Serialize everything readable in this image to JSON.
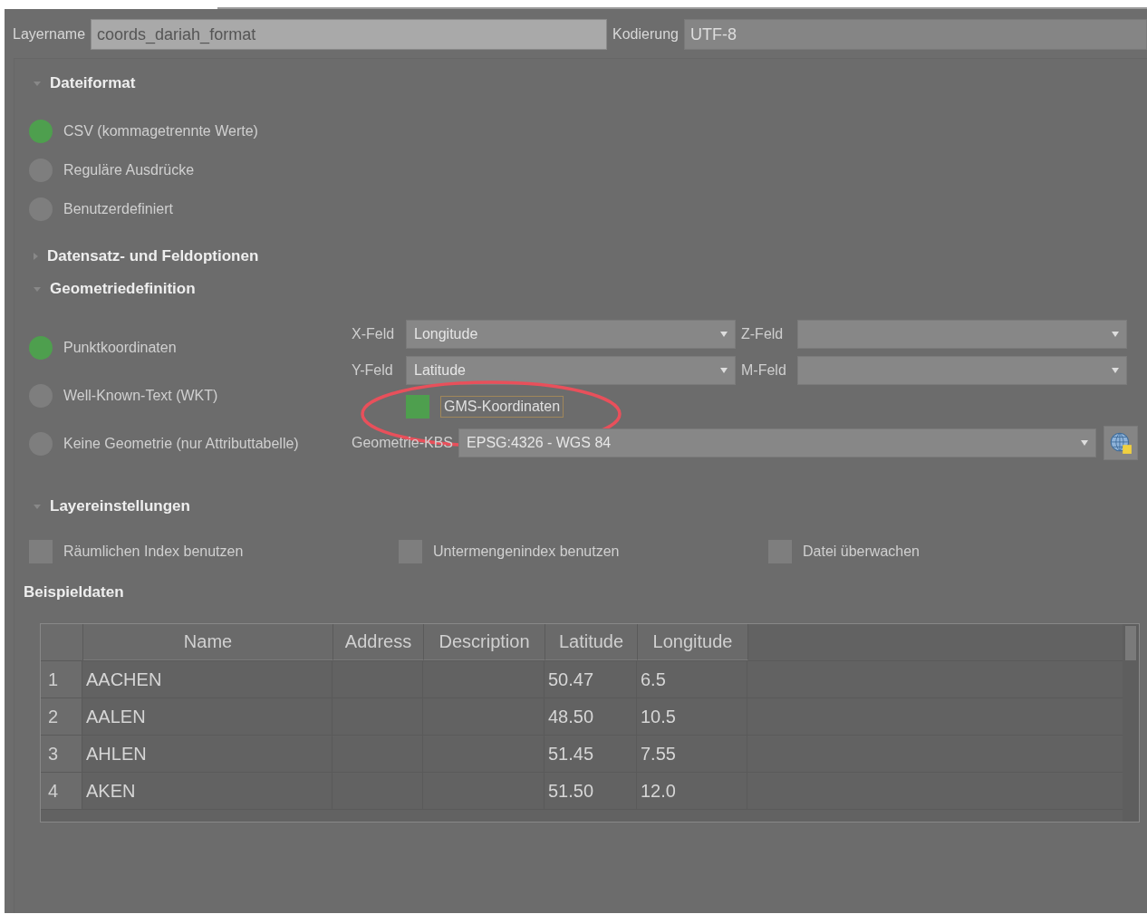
{
  "layer_name": {
    "label": "Layername",
    "value": "coords_dariah_format"
  },
  "encoding": {
    "label": "Kodierung",
    "value": "UTF-8"
  },
  "file_format": {
    "title": "Dateiformat",
    "expanded": true,
    "options": [
      {
        "label": "CSV (kommagetrennte Werte)",
        "selected": true
      },
      {
        "label": "Reguläre Ausdrücke",
        "selected": false
      },
      {
        "label": "Benutzerdefiniert",
        "selected": false
      }
    ]
  },
  "record_options": {
    "title": "Datensatz- und Feldoptionen",
    "expanded": false
  },
  "geometry": {
    "title": "Geometriedefinition",
    "expanded": true,
    "options": [
      {
        "label": "Punktkoordinaten",
        "selected": true
      },
      {
        "label": "Well-Known-Text (WKT)",
        "selected": false
      },
      {
        "label": "Keine Geometrie (nur Attributtabelle)",
        "selected": false
      }
    ],
    "x_field": {
      "label": "X-Feld",
      "value": "Longitude"
    },
    "z_field": {
      "label": "Z-Feld"
    },
    "y_field": {
      "label": "Y-Feld",
      "value": "Latitude"
    },
    "m_field": {
      "label": "M-Feld"
    },
    "dms": {
      "label": "GMS-Koordinaten",
      "checked": true
    },
    "crs": {
      "label": "Geometrie-KBS",
      "value": "EPSG:4326 - WGS 84"
    }
  },
  "layer_settings": {
    "title": "Layereinstellungen",
    "expanded": true,
    "options": [
      {
        "label": "Räumlichen Index benutzen",
        "checked": false
      },
      {
        "label": "Untermengenindex benutzen",
        "checked": false
      },
      {
        "label": "Datei überwachen",
        "checked": false
      }
    ]
  },
  "sample_data": {
    "title": "Beispieldaten",
    "columns": [
      "Name",
      "Address",
      "Description",
      "Latitude",
      "Longitude"
    ],
    "rows": [
      {
        "number": "1",
        "cells": [
          "AACHEN",
          "",
          "",
          "50.47",
          "6.5"
        ]
      },
      {
        "number": "2",
        "cells": [
          "AALEN",
          "",
          "",
          "48.50",
          "10.5"
        ]
      },
      {
        "number": "3",
        "cells": [
          "AHLEN",
          "",
          "",
          "51.45",
          "7.55"
        ]
      },
      {
        "number": "4",
        "cells": [
          "AKEN",
          "",
          "",
          "51.50",
          "12.0"
        ]
      }
    ]
  }
}
